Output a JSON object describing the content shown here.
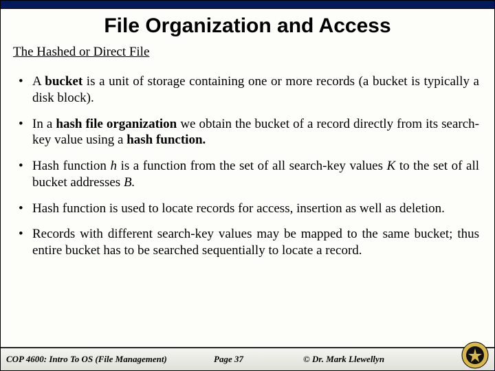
{
  "title": "File Organization and Access",
  "subtitle": "The Hashed or Direct File",
  "bullets": [
    {
      "pre": "A ",
      "bold1": "bucket",
      "mid1": " is a unit of storage containing one or more records (a bucket is typically a disk block).",
      "bold2": "",
      "mid2": ""
    },
    {
      "pre": "In a ",
      "bold1": "hash file organization",
      "mid1": " we obtain the bucket of a record directly from its search-key value using a ",
      "bold2": "hash function.",
      "mid2": ""
    },
    {
      "pre": "Hash function ",
      "ital1": "h",
      "mid1": " is a function from the set of all search-key values ",
      "ital2": "K",
      "mid2": " to the set of all bucket addresses ",
      "ital3": "B.",
      "mid3": ""
    },
    {
      "pre": "Hash function is used to locate records for access, insertion as well as deletion.",
      "bold1": "",
      "mid1": "",
      "bold2": "",
      "mid2": ""
    },
    {
      "pre": "Records with different search-key values may be mapped to the same bucket; thus entire bucket has to be searched sequentially to locate a record.",
      "bold1": "",
      "mid1": "",
      "bold2": "",
      "mid2": ""
    }
  ],
  "footer": {
    "course": "COP 4600: Intro To OS  (File Management)",
    "page": "Page 37",
    "author": "© Dr. Mark Llewellyn"
  },
  "logo_name": "ucf-pegasus-seal"
}
